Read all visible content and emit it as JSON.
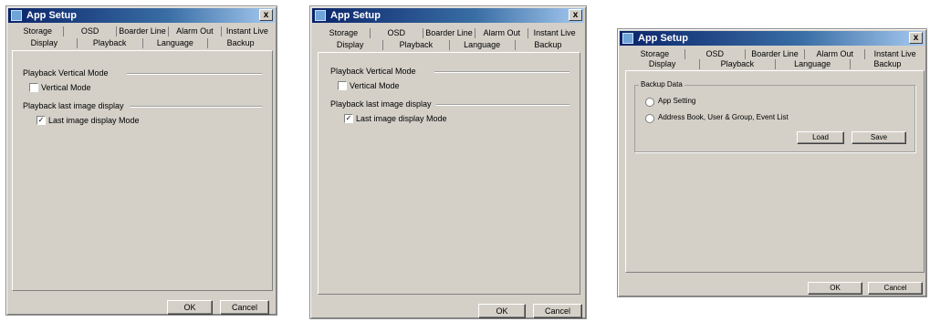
{
  "dialogs": [
    {
      "title": "App Setup",
      "close": "x",
      "tabs_row1": [
        "Storage",
        "OSD",
        "Boarder Line",
        "Alarm Out",
        "Instant Live"
      ],
      "tabs_row2": [
        "Display",
        "Playback",
        "Language",
        "Backup"
      ],
      "active_tab": "Playback",
      "section1": "Playback Vertical Mode",
      "check1": "Vertical Mode",
      "check1_checked": "",
      "section2": "Playback last image display",
      "check2": "Last image display Mode",
      "check2_checked": "✓",
      "ok": "OK",
      "cancel": "Cancel"
    },
    {
      "title": "App Setup",
      "close": "x",
      "tabs_row1": [
        "Storage",
        "OSD",
        "Boarder Line",
        "Alarm Out",
        "Instant Live"
      ],
      "tabs_row2": [
        "Display",
        "Playback",
        "Language",
        "Backup"
      ],
      "active_tab": "Playback",
      "section1": "Playback Vertical Mode",
      "check1": "Vertical Mode",
      "check1_checked": "",
      "section2": "Playback last image display",
      "check2": "Last image display Mode",
      "check2_checked": "✓",
      "ok": "OK",
      "cancel": "Cancel"
    },
    {
      "title": "App Setup",
      "close": "x",
      "tabs_row1": [
        "Storage",
        "OSD",
        "Boarder Line",
        "Alarm Out",
        "Instant Live"
      ],
      "tabs_row2": [
        "Display",
        "Playback",
        "Language",
        "Backup"
      ],
      "active_tab": "Backup",
      "group": "Backup Data",
      "radio1": "App Setting",
      "radio2": "Address Book, User & Group, Event List",
      "load": "Load",
      "save": "Save",
      "ok": "OK",
      "cancel": "Cancel"
    }
  ]
}
